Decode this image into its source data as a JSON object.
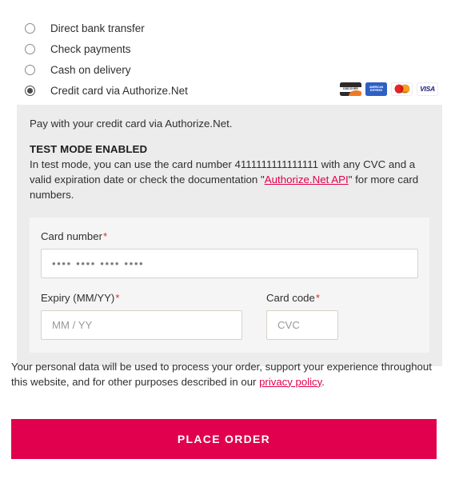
{
  "payment_methods": {
    "options": [
      {
        "label": "Direct bank transfer",
        "selected": false
      },
      {
        "label": "Check payments",
        "selected": false
      },
      {
        "label": "Cash on delivery",
        "selected": false
      },
      {
        "label": "Credit card via Authorize.Net",
        "selected": true
      }
    ]
  },
  "card_logos": [
    {
      "name": "discover-card-logo",
      "text": "DISCOVER"
    },
    {
      "name": "amex-card-logo",
      "line1": "AMERICAN",
      "line2": "EXPRESS"
    },
    {
      "name": "mastercard-card-logo",
      "text": "mastercard"
    },
    {
      "name": "visa-card-logo",
      "text": "VISA"
    }
  ],
  "payment_panel": {
    "intro": "Pay with your credit card via Authorize.Net.",
    "test_mode_title": "TEST MODE ENABLED",
    "test_body_part1": "In test mode, you can use the card number 4111111111111111 with any CVC and a valid expiration date or check the documentation \"",
    "test_link": "Authorize.Net API",
    "test_body_part2": "\" for more card numbers.",
    "test_card_number": "4111111111111111"
  },
  "card_form": {
    "card_number_label": "Card number",
    "card_number_placeholder": "•••• •••• •••• ••••",
    "card_number_value": "",
    "expiry_label": "Expiry (MM/YY)",
    "expiry_placeholder": "MM / YY",
    "expiry_value": "",
    "cvc_label": "Card code",
    "cvc_placeholder": "CVC",
    "cvc_value": "",
    "required_marker": "*"
  },
  "privacy": {
    "text_part1": "Your personal data will be used to process your order, support your experience throughout this website, and for other purposes described in our ",
    "link": "privacy policy",
    "text_part2": "."
  },
  "actions": {
    "place_order_label": "PLACE ORDER"
  },
  "colors": {
    "accent": "#e0004d",
    "panel_bg": "#ececec",
    "inner_bg": "#f5f5f5",
    "input_border": "#d8d2c8",
    "required": "#e02b2b"
  }
}
